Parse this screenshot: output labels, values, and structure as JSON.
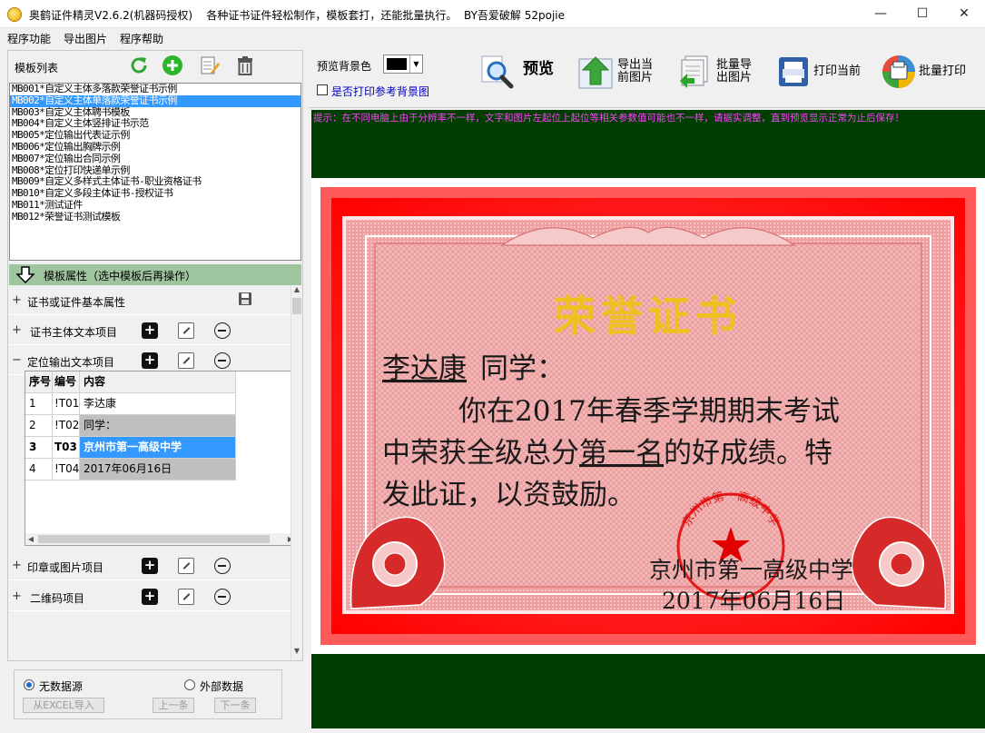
{
  "window": {
    "title": "奥鹤证件精灵V2.6.2(机器码授权)    各种证书证件轻松制作，模板套打，还能批量执行。  BY吾爱破解 52pojie",
    "minimize": "—",
    "maximize": "☐",
    "close": "✕"
  },
  "menu": [
    "程序功能",
    "导出图片",
    "程序帮助"
  ],
  "templates": {
    "label": "模板列表",
    "items": [
      "MB001*自定义主体多落款荣誉证书示例",
      "MB002*自定义主体单落款荣誉证书示例",
      "MB003*自定义主体聘书模板",
      "MB004*自定义主体竖排证书示范",
      "MB005*定位输出代表证示例",
      "MB006*定位输出胸牌示例",
      "MB007*定位输出合同示例",
      "MB008*定位打印快递单示例",
      "MB009*自定义多样式主体证书-职业资格证书",
      "MB010*自定义多段主体证书-授权证书",
      "MB011*测试证件",
      "MB012*荣誉证书测试模板"
    ],
    "selected_index": 1
  },
  "properties": {
    "title": "模板属性（选中模板后再操作）",
    "sections": [
      {
        "label": "证书或证件基本属性",
        "expanded": false
      },
      {
        "label": "证书主体文本项目",
        "expanded": false
      },
      {
        "label": "定位输出文本项目",
        "expanded": true
      },
      {
        "label": "印章或图片项目",
        "expanded": false
      },
      {
        "label": "二维码项目",
        "expanded": false
      }
    ],
    "expand_glyph": "+",
    "collapse_glyph": "−",
    "grid": {
      "headers": [
        "序号",
        "编号",
        "内容"
      ],
      "rows": [
        {
          "no": "1",
          "id": "!T01",
          "content": "李达康"
        },
        {
          "no": "2",
          "id": "!T02",
          "content": "同学："
        },
        {
          "no": "3",
          "id": "T03",
          "content": "京州市第一高级中学"
        },
        {
          "no": "4",
          "id": "!T04",
          "content": "2017年06月16日"
        }
      ]
    }
  },
  "datasource": {
    "option_none": "无数据源",
    "option_external": "外部数据",
    "import_button": "从EXCEL导入",
    "prev_button": "上一条",
    "next_button": "下一条"
  },
  "toolbar": {
    "bg_color_label": "预览背景色",
    "bg_color": "#000000",
    "print_ref_label": "是否打印参考背景图",
    "preview": "预览",
    "export_current": "导出当\n前图片",
    "batch_export": "批量导\n出图片",
    "print_current": "打印当前",
    "batch_print": "批量打印"
  },
  "hint": "提示：在不同电脑上由于分辨率不一样，文字和图片左起位上起位等相关参数值可能也不一样，请据实调整，直到预览显示正常为止后保存！",
  "certificate": {
    "heading": "荣誉证书",
    "name": "李达康",
    "name_suffix": "同学：",
    "line1": "你在2017年春季学期期末考试",
    "line2_pre": "中荣获全级总分",
    "line2_emph": "第一名",
    "line2_post": "的好成绩。特",
    "line3": "发此证，以资鼓励。",
    "issuer": "京州市第一高级中学",
    "date": "2017年06月16日",
    "seal_text": "京州市第一高级中学",
    "colors": {
      "background": "#003d00",
      "frame": "#ff1a1a",
      "heading": "#f0c020",
      "hint": "#ff40ff"
    }
  }
}
